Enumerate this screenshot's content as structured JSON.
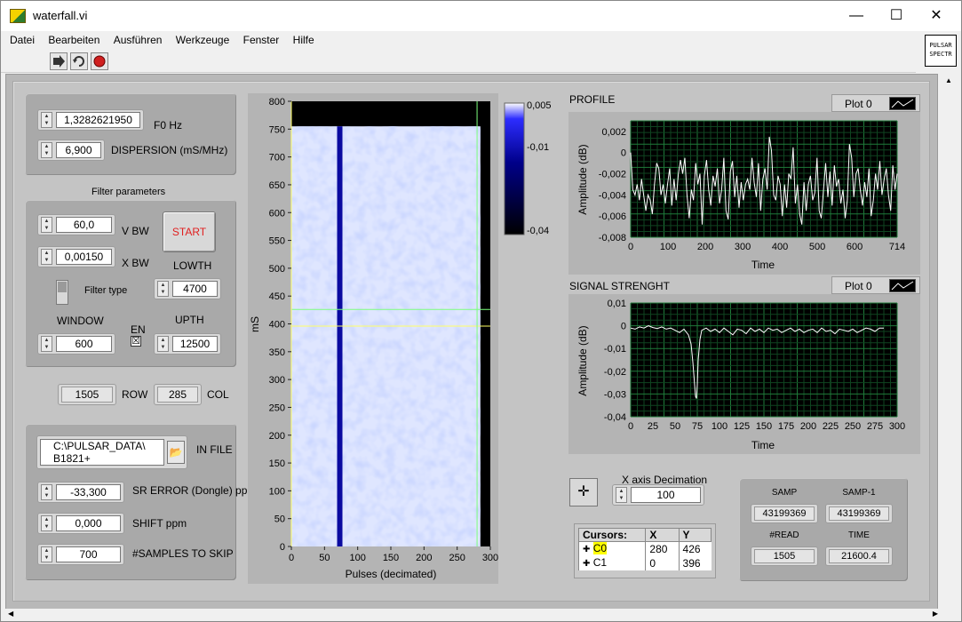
{
  "window": {
    "title": "waterfall.vi",
    "icon": "labview-vi-icon"
  },
  "menu": [
    "Datei",
    "Bearbeiten",
    "Ausführen",
    "Werkzeuge",
    "Fenster",
    "Hilfe"
  ],
  "toolbar": {
    "icons": [
      "run-arrow-icon",
      "run-continuous-icon",
      "abort-icon"
    ]
  },
  "vi_icon": {
    "line1": "PULSAR",
    "line2": "SPECTR"
  },
  "controls": {
    "f0": {
      "value": "1,3282621950",
      "label": "F0 Hz"
    },
    "dispersion": {
      "value": "6,900",
      "label": "DISPERSION (mS/MHz)"
    },
    "filter_title": "Filter parameters",
    "vbw": {
      "value": "60,0",
      "label": "V BW"
    },
    "xbw": {
      "value": "0,00150",
      "label": "X BW"
    },
    "start_label": "START",
    "lowth": {
      "value": "4700",
      "label": "LOWTH"
    },
    "filter_type_label": "Filter type",
    "window": {
      "value": "600",
      "label": "WINDOW"
    },
    "en_label": "EN",
    "en_checked": "☒",
    "upth": {
      "value": "12500",
      "label": "UPTH"
    },
    "row": {
      "value": "1505",
      "label": "ROW"
    },
    "col": {
      "value": "285",
      "label": "COL"
    },
    "infile": {
      "line1": "C:\\PULSAR_DATA\\",
      "line2": "B1821+",
      "label": "IN FILE"
    },
    "sr_error": {
      "value": "-33,300",
      "label": "SR ERROR (Dongle) ppm"
    },
    "shift": {
      "value": "0,000",
      "label": "SHIFT ppm"
    },
    "skip": {
      "value": "700",
      "label": "#SAMPLES TO SKIP"
    }
  },
  "waterfall": {
    "ylabel": "mS",
    "xlabel": "Pulses (decimated)",
    "y_ticks": [
      "0",
      "50",
      "100",
      "150",
      "200",
      "250",
      "300",
      "350",
      "400",
      "450",
      "500",
      "550",
      "600",
      "650",
      "700",
      "750",
      "800"
    ],
    "x_ticks": [
      "0",
      "50",
      "100",
      "150",
      "200",
      "250",
      "300"
    ],
    "colorbar_ticks": [
      "0,005",
      "-0,01",
      "-0,04"
    ]
  },
  "profile": {
    "title": "PROFILE",
    "legend": "Plot 0",
    "ylabel": "Amplitude (dB)",
    "xlabel": "Time",
    "y_ticks": [
      "0,002",
      "0",
      "-0,002",
      "-0,004",
      "-0,006",
      "-0,008"
    ],
    "x_ticks": [
      "0",
      "100",
      "200",
      "300",
      "400",
      "500",
      "600",
      "714"
    ]
  },
  "signal": {
    "title": "SIGNAL STRENGHT",
    "legend": "Plot 0",
    "ylabel": "Amplitude (dB)",
    "xlabel": "Time",
    "y_ticks": [
      "0,01",
      "0",
      "-0,01",
      "-0,02",
      "-0,03",
      "-0,04"
    ],
    "x_ticks": [
      "0",
      "25",
      "50",
      "75",
      "100",
      "125",
      "150",
      "175",
      "200",
      "225",
      "250",
      "275",
      "300"
    ]
  },
  "decimation": {
    "label": "X axis Decimation",
    "value": "100"
  },
  "cursors": {
    "header": [
      "Cursors:",
      "X",
      "Y"
    ],
    "rows": [
      {
        "name": "C0",
        "x": "280",
        "y": "426"
      },
      {
        "name": "C1",
        "x": "0",
        "y": "396"
      }
    ]
  },
  "samples": {
    "samp": {
      "label": "SAMP",
      "value": "43199369"
    },
    "samp1": {
      "label": "SAMP-1",
      "value": "43199369"
    },
    "read": {
      "label": "#READ",
      "value": "1505"
    },
    "time": {
      "label": "TIME",
      "value": "21600.4"
    }
  },
  "chart_data": [
    {
      "type": "heatmap",
      "xlabel": "Pulses (decimated)",
      "ylabel": "mS",
      "xlim": [
        0,
        300
      ],
      "ylim": [
        0,
        800
      ],
      "data_extent_x": [
        0,
        285
      ],
      "data_extent_y": [
        0,
        755
      ],
      "pulse_column_x": 73,
      "cursors": [
        {
          "x": 280,
          "y": 426
        },
        {
          "x": 0,
          "y": 396
        }
      ],
      "colorbar": {
        "min": -0.04,
        "max": 0.005
      }
    },
    {
      "type": "line",
      "title": "PROFILE",
      "xlabel": "Time",
      "ylabel": "Amplitude (dB)",
      "xlim": [
        0,
        714
      ],
      "ylim": [
        -0.008,
        0.003
      ],
      "series": [
        {
          "name": "Plot 0",
          "values": [
            0,
            -0.0035,
            -0.004,
            -0.003,
            -0.0045,
            -0.0025,
            -0.004,
            -0.0055,
            -0.004,
            -0.0045,
            -0.0058,
            -0.003,
            -0.001,
            -0.0015,
            -0.004,
            -0.003,
            -0.0048,
            -0.003,
            -0.0015,
            -0.005,
            -0.0025,
            -0.0045,
            -0.002,
            -0.0007,
            -0.002,
            -0.0005,
            -0.004,
            -0.0062,
            -0.0035,
            -0.0045,
            -0.001,
            -0.003,
            -0.002,
            -0.0068,
            -0.0022,
            -0.0007,
            -0.0035,
            -0.005,
            -0.0022,
            -0.0032,
            -0.0015,
            -0.0048,
            -0.0035,
            -0.0005,
            -0.0055,
            -0.0063,
            -0.0018,
            -0.0008,
            -0.0042,
            -0.0022,
            -0.0052,
            -0.0028,
            -0.0045,
            -0.003,
            -0.0025,
            -0.0035,
            -0.0005,
            -0.0028,
            -0.0042,
            -0.001,
            -0.0055,
            -0.0025,
            -0.0015,
            -0.0035,
            0.0015,
            0.0002,
            -0.004,
            -0.0045,
            -0.0022,
            -0.003,
            -0.006,
            -0.003,
            -0.0052,
            -0.002,
            -0.0025,
            0.0005,
            -0.0048,
            -0.003,
            -0.0058,
            -0.0068,
            -0.0028,
            -0.0055,
            -0.003,
            -0.0022,
            -0.0045,
            -0.0038,
            -0.0005,
            -0.0055,
            -0.0062,
            -0.0035,
            -0.001,
            -0.0042,
            -0.0018,
            -0.005,
            -0.0012,
            -0.0032,
            -0.0025,
            -0.0048,
            -0.0035,
            -0.0062,
            -0.0045,
            0.0008,
            -0.0005,
            -0.0042,
            -0.002,
            -0.0015,
            -0.0035,
            -0.005,
            -0.0028,
            -0.0042,
            -0.0015,
            -0.006,
            -0.0045,
            -0.002,
            -0.0035,
            -0.0008,
            -0.004,
            -0.0025,
            -0.0015,
            -0.004,
            -0.0055,
            -0.0012,
            -0.0035,
            -0.002
          ]
        }
      ]
    },
    {
      "type": "line",
      "title": "SIGNAL STRENGHT",
      "xlabel": "Time",
      "ylabel": "Amplitude (dB)",
      "xlim": [
        0,
        300
      ],
      "ylim": [
        -0.04,
        0.01
      ],
      "series": [
        {
          "name": "Plot 0",
          "x": [
            0,
            5,
            10,
            15,
            20,
            25,
            30,
            35,
            40,
            45,
            50,
            55,
            60,
            65,
            68,
            70,
            72,
            73,
            74,
            75,
            76,
            78,
            80,
            85,
            90,
            95,
            100,
            105,
            110,
            115,
            120,
            125,
            130,
            135,
            140,
            145,
            150,
            155,
            160,
            165,
            170,
            175,
            180,
            185,
            190,
            195,
            200,
            205,
            210,
            215,
            220,
            225,
            230,
            235,
            240,
            245,
            250,
            255,
            260,
            265,
            270,
            275,
            280,
            285
          ],
          "values": [
            -0.001,
            -0.0015,
            -0.0005,
            -0.001,
            0,
            -0.0008,
            -0.0012,
            -0.0005,
            -0.0015,
            -0.001,
            -0.002,
            -0.003,
            -0.0015,
            -0.004,
            -0.008,
            -0.016,
            -0.026,
            -0.031,
            -0.032,
            -0.026,
            -0.015,
            -0.006,
            -0.002,
            -0.001,
            -0.0025,
            -0.0015,
            -0.003,
            -0.001,
            -0.0025,
            -0.004,
            -0.0015,
            -0.002,
            -0.0035,
            -0.001,
            -0.0025,
            -0.0015,
            -0.003,
            -0.001,
            -0.002,
            -0.0015,
            -0.003,
            -0.002,
            -0.001,
            -0.0025,
            -0.0015,
            -0.003,
            -0.002,
            -0.0015,
            -0.003,
            -0.001,
            -0.0025,
            -0.002,
            -0.0035,
            -0.0015,
            -0.002,
            -0.0025,
            -0.0015,
            -0.003,
            -0.002,
            -0.001,
            -0.0015,
            -0.0025,
            -0.001,
            -0.001
          ]
        }
      ]
    }
  ]
}
